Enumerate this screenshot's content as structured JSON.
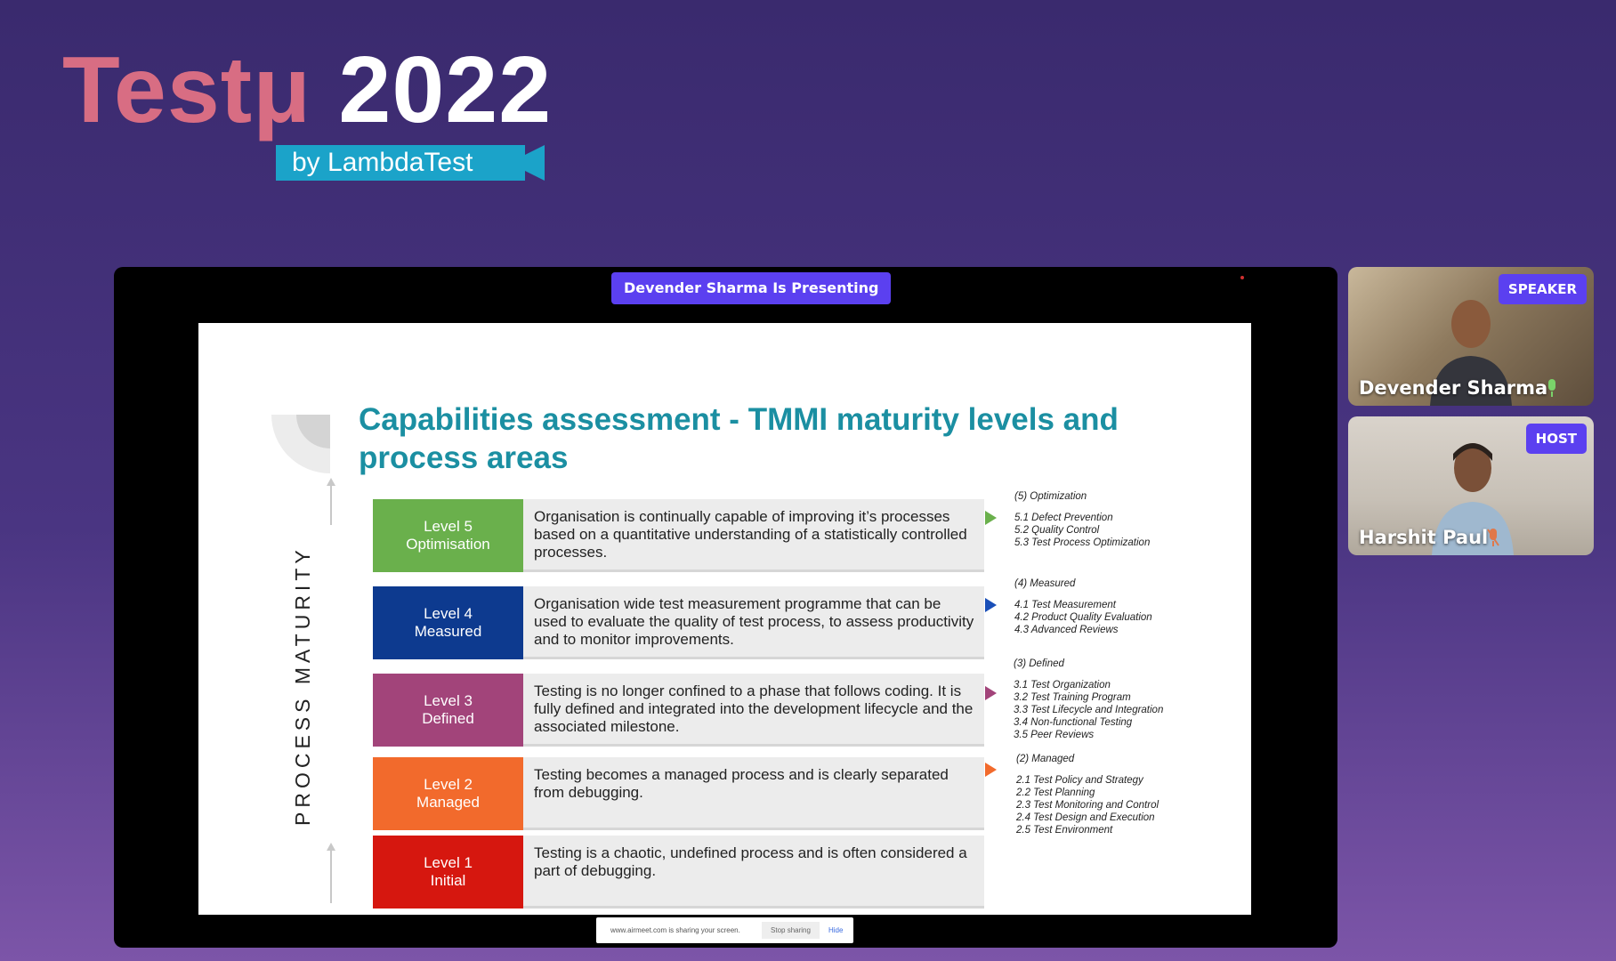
{
  "brand": {
    "title_part1": "Testμ",
    "title_part2": "2022",
    "subtitle": "by LambdaTest"
  },
  "stage": {
    "presenting_label": "Devender Sharma Is Presenting"
  },
  "slide": {
    "title": "Capabilities assessment - TMMI maturity levels and process areas",
    "side_label": "PROCESS MATURITY",
    "levels": [
      {
        "name": "Level 5\nOptimisation",
        "color": "#6ab04c",
        "arrow_color": "#6ab04c",
        "description": "Organisation is continually capable of improving it’s processes based on a quantitative understanding of a statistically controlled processes."
      },
      {
        "name": "Level 4\nMeasured",
        "color": "#0d3a8f",
        "arrow_color": "#1a4fb8",
        "description": "Organisation wide test measurement programme that can be used to evaluate the quality of test process, to assess productivity and to monitor improvements."
      },
      {
        "name": "Level 3\nDefined",
        "color": "#a2447a",
        "arrow_color": "#a2447a",
        "description": "Testing is no longer confined to a phase that follows coding. It is fully defined and integrated into the development lifecycle and the associated milestone."
      },
      {
        "name": "Level 2\nManaged",
        "color": "#f26a2c",
        "arrow_color": "#f26a2c",
        "description": "Testing becomes a managed process and is clearly separated from debugging."
      },
      {
        "name": "Level 1\nInitial",
        "color": "#d6170f",
        "arrow_color": "",
        "description": "Testing is a chaotic, undefined process and is often considered a part of debugging."
      }
    ],
    "process_areas": [
      {
        "title": "(5) Optimization",
        "items": [
          "5.1 Defect Prevention",
          "5.2 Quality Control",
          "5.3 Test Process Optimization"
        ]
      },
      {
        "title": "(4) Measured",
        "items": [
          "4.1 Test Measurement",
          "4.2 Product Quality Evaluation",
          "4.3 Advanced Reviews"
        ]
      },
      {
        "title": "(3) Defined",
        "items": [
          "3.1 Test Organization",
          "3.2 Test Training Program",
          "3.3 Test Lifecycle and Integration",
          "3.4 Non-functional Testing",
          "3.5 Peer Reviews"
        ]
      },
      {
        "title": "(2) Managed",
        "items": [
          "2.1 Test Policy and Strategy",
          "2.2 Test Planning",
          "2.3 Test Monitoring and Control",
          "2.4 Test Design and Execution",
          "2.5 Test Environment"
        ]
      }
    ]
  },
  "share_bar": {
    "message": "www.airmeet.com is sharing your screen.",
    "stop_label": "Stop sharing",
    "hide_label": "Hide"
  },
  "participants": [
    {
      "name": "Devender Sharma",
      "role": "SPEAKER",
      "mic_icon": "mic-active-icon"
    },
    {
      "name": "Harshit Paul",
      "role": "HOST",
      "mic_icon": "mic-muted-icon"
    }
  ]
}
